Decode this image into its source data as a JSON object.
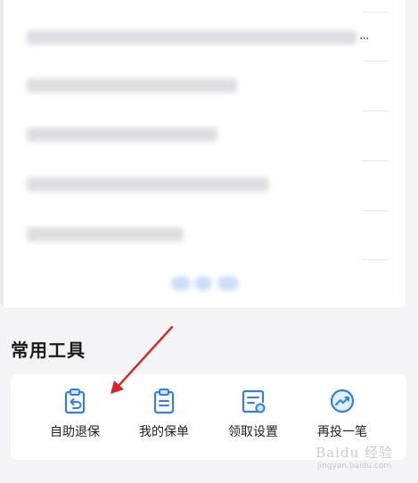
{
  "faq_list": {
    "last_item_ellipsis": "..."
  },
  "tools": {
    "title": "常用工具",
    "items": [
      {
        "label": "自助退保",
        "icon": "clipboard-return-icon"
      },
      {
        "label": "我的保单",
        "icon": "policy-document-icon"
      },
      {
        "label": "领取设置",
        "icon": "payout-settings-icon"
      },
      {
        "label": "再投一笔",
        "icon": "reinvest-chart-icon"
      }
    ]
  },
  "watermark": {
    "main": "Baidu 经验",
    "sub": "jingyan.baidu.com"
  },
  "colors": {
    "accent": "#2f7fe6",
    "annotation_arrow": "#e02020",
    "page_bg": "#f4f4f6",
    "card_bg": "#ffffff"
  }
}
